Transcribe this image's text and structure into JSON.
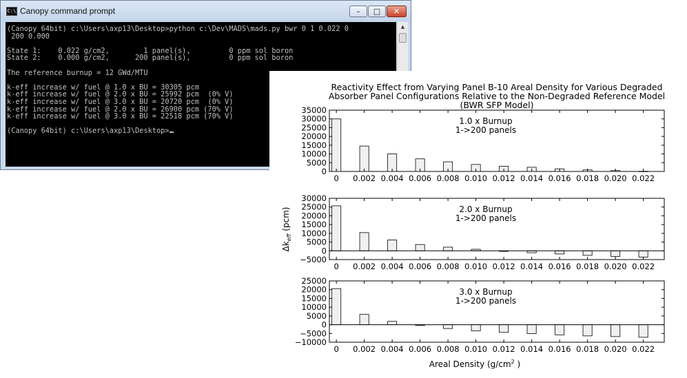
{
  "window": {
    "title": "Canopy command prompt",
    "icon_text": "C:\\",
    "buttons": {
      "minimize": "minimize-icon",
      "maximize": "maximize-icon",
      "close": "close-icon"
    }
  },
  "console": {
    "lines": [
      "(Canopy 64bit) c:\\Users\\axp13\\Desktop>python c:\\Dev\\MADS\\mads.py bwr 0 1 0.022 0",
      " 200 0.000",
      "",
      "State 1:    0.022 g/cm2,        1 panel(s),         0 ppm sol boron",
      "State 2:    0.000 g/cm2,      200 panel(s),         0 ppm sol boron",
      "",
      "The reference burnup = 12 GWd/MTU",
      "",
      "k-eff increase w/ fuel @ 1.0 x BU = 30305 pcm",
      "k-eff increase w/ fuel @ 2.0 x BU = 25992 pcm  (0% V)",
      "k-eff increase w/ fuel @ 3.0 x BU = 20720 pcm  (0% V)",
      "k-eff increase w/ fuel @ 2.0 x BU = 26900 pcm (70% V)",
      "k-eff increase w/ fuel @ 3.0 x BU = 22518 pcm (70% V)",
      "",
      "(Canopy 64bit) c:\\Users\\axp13\\Desktop>"
    ]
  },
  "chart_data": {
    "type": "bar",
    "title": [
      "Reactivity Effect from Varying Panel B-10 Areal Density for Various Degraded",
      "Absorber Panel Configurations Relative to the Non-Degraded Reference Model",
      "(BWR SFP Model)"
    ],
    "ylabel_main": "Δk",
    "ylabel_sub": "eff",
    "ylabel_unit": " (pcm)",
    "xlabel_main": "Areal Density (g/cm",
    "xlabel_sup": "2",
    "xlabel_end": " )",
    "x": [
      0,
      0.002,
      0.004,
      0.006,
      0.008,
      0.01,
      0.012,
      0.014,
      0.016,
      0.018,
      0.02,
      0.022
    ],
    "x_tick_labels": [
      "0",
      "0.002",
      "0.004",
      "0.006",
      "0.008",
      "0.010",
      "0.012",
      "0.014",
      "0.016",
      "0.018",
      "0.020",
      "0.022"
    ],
    "bar_color": "#f0f0f0",
    "grid": false,
    "panels": [
      {
        "label": [
          "1.0 x Burnup",
          "1->200 panels"
        ],
        "ylim": [
          0,
          35000
        ],
        "yticks": [
          0,
          5000,
          10000,
          15000,
          20000,
          25000,
          30000,
          35000
        ],
        "ytick_labels": [
          "0",
          "5000",
          "10000",
          "15000",
          "20000",
          "25000",
          "30000",
          "35000"
        ],
        "values": [
          30000,
          14500,
          10000,
          7200,
          5500,
          4000,
          3000,
          2400,
          1500,
          900,
          500,
          100
        ]
      },
      {
        "label": [
          "2.0 x Burnup",
          "1->200 panels"
        ],
        "ylim": [
          -5000,
          30000
        ],
        "yticks": [
          -5000,
          0,
          5000,
          10000,
          15000,
          20000,
          25000,
          30000
        ],
        "ytick_labels": [
          "−5000",
          "0",
          "5000",
          "10000",
          "15000",
          "20000",
          "25000",
          "30000"
        ],
        "values": [
          25700,
          10400,
          6200,
          3600,
          2100,
          900,
          -300,
          -1100,
          -1800,
          -2600,
          -3200,
          -3600
        ]
      },
      {
        "label": [
          "3.0 x Burnup",
          "1->200 panels"
        ],
        "ylim": [
          -10000,
          25000
        ],
        "yticks": [
          -10000,
          -5000,
          0,
          5000,
          10000,
          15000,
          20000,
          25000
        ],
        "ytick_labels": [
          "−10000",
          "−5000",
          "0",
          "5000",
          "10000",
          "15000",
          "20000",
          "25000"
        ],
        "values": [
          20600,
          5900,
          1900,
          -500,
          -2200,
          -3500,
          -4400,
          -5100,
          -5800,
          -6400,
          -6800,
          -7200
        ]
      }
    ]
  }
}
